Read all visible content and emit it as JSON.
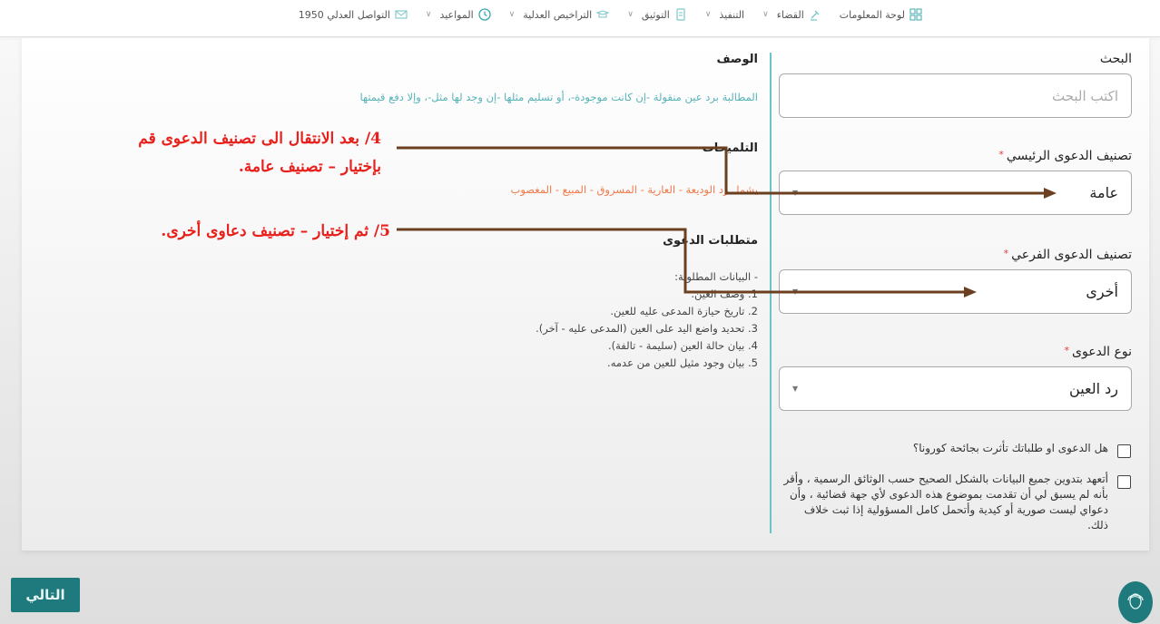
{
  "nav": {
    "items": [
      {
        "label": "لوحة المعلومات",
        "icon": "dashboard-icon",
        "has_chevron": false
      },
      {
        "label": "القضاء",
        "icon": "gavel-icon",
        "has_chevron": true
      },
      {
        "label": "التنفيذ",
        "icon": "",
        "has_chevron": true
      },
      {
        "label": "التوثيق",
        "icon": "document-icon",
        "has_chevron": true
      },
      {
        "label": "التراخيص العدلية",
        "icon": "license-icon",
        "has_chevron": true
      },
      {
        "label": "المواعيد",
        "icon": "clock-icon",
        "has_chevron": true
      },
      {
        "label": "التواصل العدلي 1950",
        "icon": "mail-icon",
        "has_chevron": false
      }
    ],
    "chevron": "∨"
  },
  "form": {
    "search": {
      "label": "البحث",
      "placeholder": "اكتب البحث",
      "value": ""
    },
    "main_category": {
      "label": "تصنيف الدعوى الرئيسي",
      "required_mark": "*",
      "value": "عامة"
    },
    "sub_category": {
      "label": "تصنيف الدعوى الفرعي",
      "required_mark": "*",
      "value": "أخرى"
    },
    "case_type": {
      "label": "نوع الدعوى",
      "required_mark": "*",
      "value": "رد العين"
    },
    "checkboxes": [
      {
        "label": "هل الدعوى او طلباتك تأثرت بجائحة كورونا؟",
        "checked": false
      },
      {
        "label": "أتعهد بتدوين جميع البيانات بالشكل الصحيح حسب الوثائق الرسمية ، وأقر بأنه لم يسبق لي أن تقدمت بموضوع هذه الدعوى لأي جهة قضائية ، وأن دعواي ليست صورية أو كيدية وأتحمل كامل المسؤولية إذا ثبت خلاف ذلك.",
        "checked": false
      }
    ]
  },
  "info": {
    "description_title": "الوصف",
    "description": "المطالبة برد عين منقولة -إن كانت موجودة-، أو تسليم مثلها -إن وجد لها مثل-، وإلا دفع قيمتها",
    "hints_title": "التلميحات",
    "hints": "يشمل رد الوديعة - العارية - المسروق - المبيع - المغصوب",
    "requirements_title": "متطلبات الدعوى",
    "requirements_intro": "- البيانات المطلوبة:",
    "requirements": [
      "1. وصف العين.",
      "2. تاريخ حيازة المدعى عليه للعين.",
      "3. تحديد واضع اليد على العين (المدعى عليه - آخر).",
      "4. بيان حالة العين (سليمة - تالفة).",
      "5. بيان وجود مثيل للعين من عدمه."
    ]
  },
  "annotations": {
    "step4_line1": "4/ بعد الانتقال الى تصنيف الدعوى قم",
    "step4_line2": "بإختيار – تصنيف عامة.",
    "step5": "5/ ثم إختيار – تصنيف دعاوى أخرى.",
    "color": "#e8201c",
    "arrow_color": "#6b3f1f"
  },
  "buttons": {
    "next": "التالي",
    "support_icon": "support-agent-icon"
  }
}
